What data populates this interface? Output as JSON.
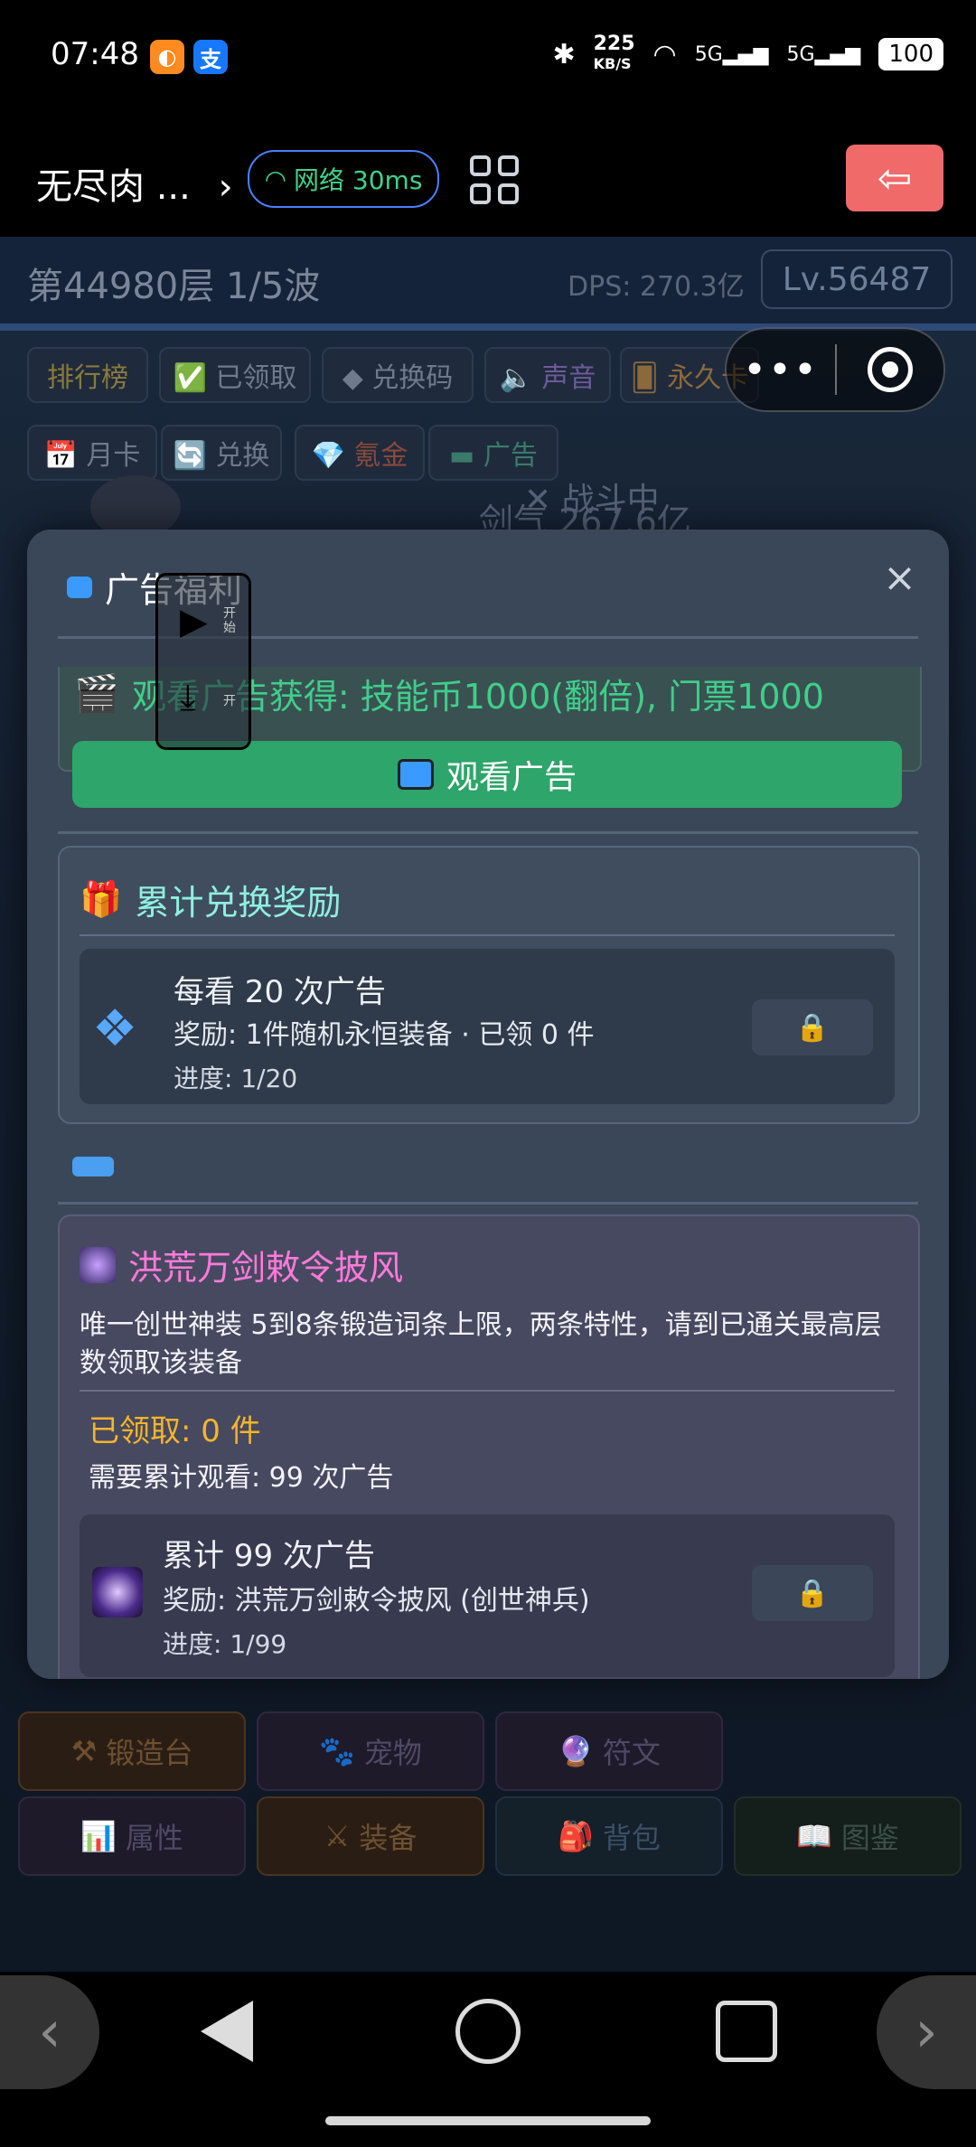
{
  "status_bar": {
    "time": "07:48",
    "net_speed_value": "225",
    "net_speed_unit": "KB/S",
    "signal1": "5G",
    "signal2": "5G",
    "battery": "100"
  },
  "mini_bar": {
    "app_name": "无尽肉 ...",
    "chevron": "›",
    "network": "网络 30ms"
  },
  "hud": {
    "level": "第44980层 1/5波",
    "dps": "DPS: 270.3亿",
    "lv": "Lv.56487"
  },
  "top_chips": {
    "row1": [
      "排行榜",
      "✅ 已领取",
      "◆ 兑换码",
      "🔈 声音",
      "🂠 永久卡"
    ],
    "row2": [
      "📅 月卡",
      "🔄 兑换",
      "💎 氪金",
      "▬ 广告"
    ]
  },
  "battle_text": "✕ 战斗中",
  "battle_sub": "剑气 267.6亿",
  "modal": {
    "title": "广告福利",
    "close": "×",
    "ad_reward_text": "观看广告获得: 技能币1000(翻倍), 门票1000",
    "watch_button": "观看广告",
    "accum_section": {
      "title": "累计兑换奖励",
      "item": {
        "line1": "每看 20 次广告",
        "line2": "奖励: 1件随机永恒装备 · 已领 0 件",
        "line3": "进度: 1/20",
        "lock": "🔒"
      }
    },
    "special_section": {
      "title": "洪荒万剑敕令披风",
      "desc": "唯一创世神装 5到8条锻造词条上限，两条特性，请到已通关最高层数领取该装备",
      "claimed": "已领取: 0 件",
      "need": "需要累计观看: 99 次广告",
      "item": {
        "line1": "累计 99 次广告",
        "line2": "奖励: 洪荒万剑敕令披风 (创世神兵)",
        "line3": "进度: 1/99",
        "lock": "🔒"
      }
    }
  },
  "media_widget": {
    "play_label": "开始",
    "download_label": "开"
  },
  "bottom_buttons": {
    "row1": [
      "锻造台",
      "宠物",
      "符文"
    ],
    "row2": [
      "属性",
      "装备",
      "背包",
      "图鉴"
    ]
  },
  "colors": {
    "accent_green": "#2ea56a",
    "text_green": "#3fcf8a",
    "title_cyan": "#8ff0e0",
    "title_pink": "#ff7ad9",
    "gold": "#f5b52a",
    "exit_red": "#f06a6a"
  },
  "icons": [
    "bluetooth-icon",
    "wifi-icon",
    "signal-icon",
    "battery-icon",
    "grid-icon",
    "exit-icon",
    "tv-icon",
    "clapper-icon",
    "gift-icon",
    "diamond-icon",
    "lock-icon",
    "cloak-icon",
    "play-icon",
    "download-icon",
    "back-icon",
    "home-icon",
    "recents-icon"
  ]
}
